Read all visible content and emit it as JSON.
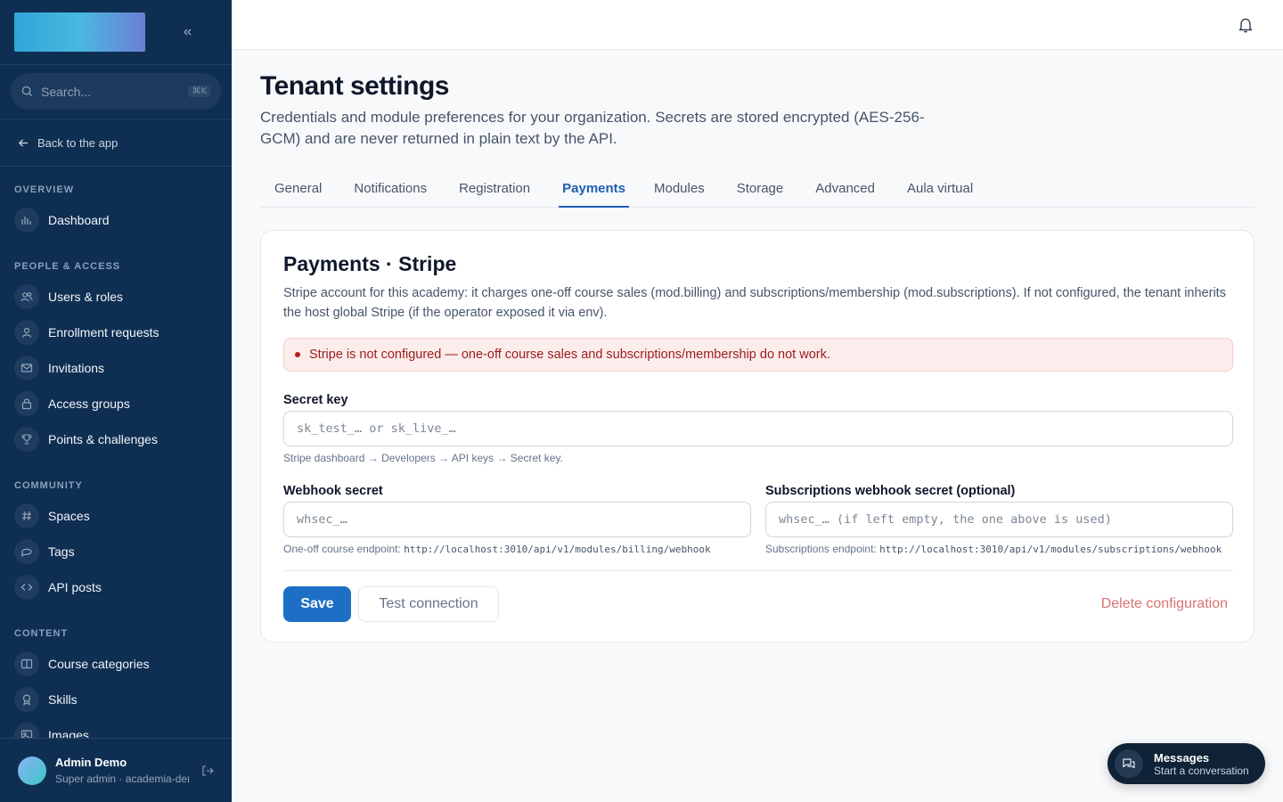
{
  "sidebar": {
    "search_placeholder": "Search...",
    "search_shortcut": "⌘K",
    "back_label": "Back to the app",
    "sections": {
      "overview": "OVERVIEW",
      "people": "PEOPLE & ACCESS",
      "community": "COMMUNITY",
      "content": "CONTENT"
    },
    "items": {
      "dashboard": "Dashboard",
      "users": "Users & roles",
      "enrollment": "Enrollment requests",
      "invitations": "Invitations",
      "access_groups": "Access groups",
      "points": "Points & challenges",
      "spaces": "Spaces",
      "tags": "Tags",
      "api_posts": "API posts",
      "course_categories": "Course categories",
      "skills": "Skills",
      "images": "Images"
    },
    "user": {
      "name": "Admin Demo",
      "role": "Super admin · academia-demo"
    }
  },
  "page": {
    "title": "Tenant settings",
    "description": "Credentials and module preferences for your organization. Secrets are stored encrypted (AES-256-GCM) and are never returned in plain text by the API.",
    "tabs": [
      "General",
      "Notifications",
      "Registration",
      "Payments",
      "Modules",
      "Storage",
      "Advanced",
      "Aula virtual"
    ],
    "active_tab": "Payments"
  },
  "card": {
    "title": "Payments · Stripe",
    "description": "Stripe account for this academy: it charges one-off course sales (mod.billing) and subscriptions/membership (mod.subscriptions). If not configured, the tenant inherits the host global Stripe (if the operator exposed it via env).",
    "alert": "Stripe is not configured — one-off course sales and subscriptions/membership do not work.",
    "secret_key": {
      "label": "Secret key",
      "placeholder": "sk_test_… or sk_live_…",
      "hint": "Stripe dashboard → Developers → API keys → Secret key."
    },
    "webhook": {
      "label": "Webhook secret",
      "placeholder": "whsec_…",
      "hint_prefix": "One-off course endpoint:",
      "hint_url": "http://localhost:3010/api/v1/modules/billing/webhook"
    },
    "sub_webhook": {
      "label": "Subscriptions webhook secret (optional)",
      "placeholder": "whsec_… (if left empty, the one above is used)",
      "hint_prefix": "Subscriptions endpoint:",
      "hint_url": "http://localhost:3010/api/v1/modules/subscriptions/webhook"
    },
    "save_label": "Save",
    "test_label": "Test connection",
    "delete_label": "Delete configuration"
  },
  "messages": {
    "title": "Messages",
    "subtitle": "Start a conversation"
  },
  "colors": {
    "sidebar_bg": "#0f2f52",
    "accent": "#1d6fc6",
    "danger": "#b91c1c"
  }
}
